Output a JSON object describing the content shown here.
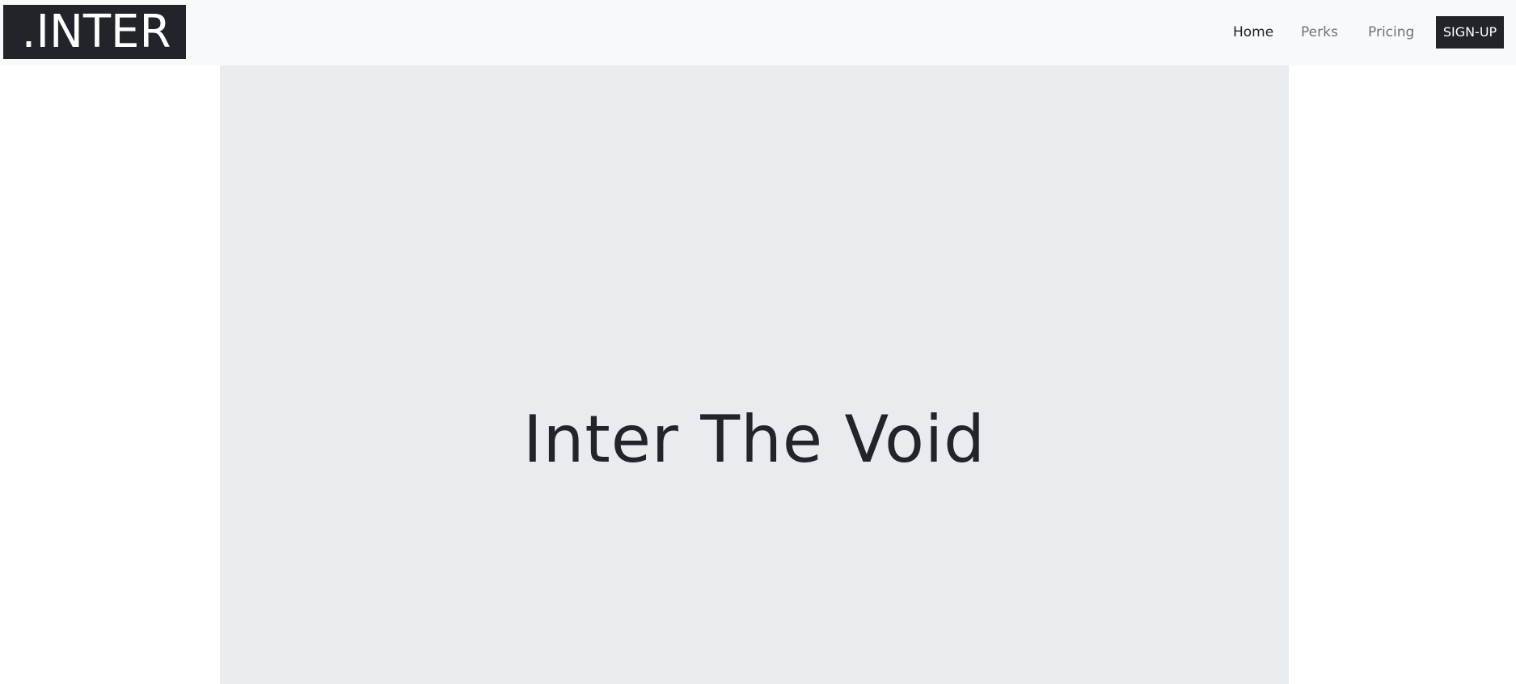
{
  "navbar": {
    "brand": ".INTER",
    "links": [
      {
        "label": "Home",
        "active": true
      },
      {
        "label": "Perks",
        "active": false
      },
      {
        "label": "Pricing",
        "active": false
      }
    ],
    "cta_label": "SIGN-UP"
  },
  "hero": {
    "title": "Inter The Void"
  },
  "colors": {
    "navbar_bg": "#f8f9fa",
    "brand_bg": "#212529",
    "hero_bg": "#e9ecef",
    "text_dark": "#212529",
    "text_muted": "#6c757d"
  }
}
